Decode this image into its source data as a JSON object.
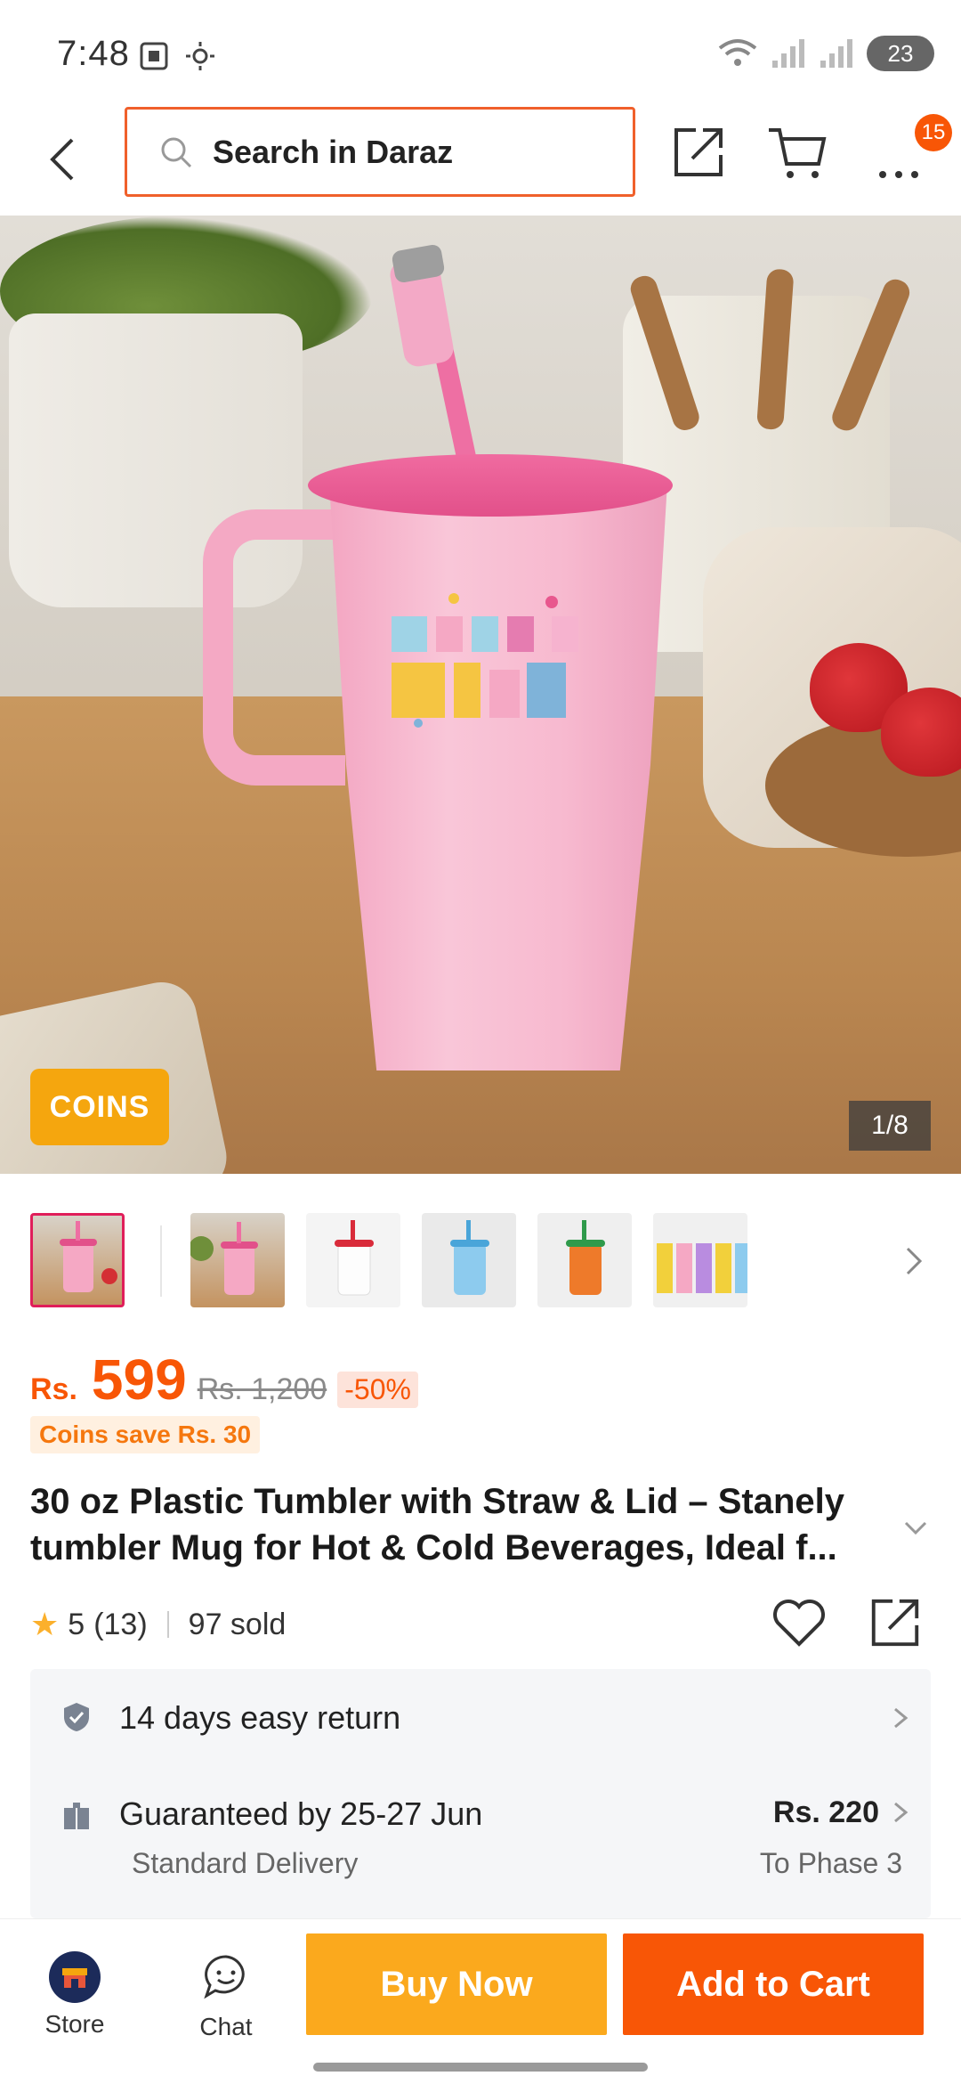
{
  "status_bar": {
    "time": "7:48",
    "battery": "23"
  },
  "header": {
    "search_placeholder": "Search in Daraz",
    "cart_badge": "15"
  },
  "gallery": {
    "coins_label": "COINS",
    "counter": "1/8",
    "thumbnail_count": 6
  },
  "price": {
    "currency": "Rs.",
    "current": "599",
    "original": "Rs. 1,200",
    "discount": "-50%",
    "coins_save": "Coins save Rs. 30"
  },
  "product": {
    "title": "30 oz Plastic Tumbler with Straw & Lid – Stanely tumbler Mug for Hot & Cold Beverages, Ideal f..."
  },
  "rating": {
    "score": "5",
    "count": "(13)",
    "sold": "97 sold"
  },
  "info": {
    "return_text": "14 days easy return",
    "delivery_text": "Guaranteed by 25-27 Jun",
    "delivery_type": "Standard Delivery",
    "delivery_price": "Rs. 220",
    "delivery_location": "To Phase 3"
  },
  "bottom_bar": {
    "store_label": "Store",
    "chat_label": "Chat",
    "buy_now_label": "Buy Now",
    "add_to_cart_label": "Add to Cart"
  },
  "colors": {
    "accent": "#f85606",
    "buy_now": "#fba91d",
    "coins": "#f5a60e"
  }
}
